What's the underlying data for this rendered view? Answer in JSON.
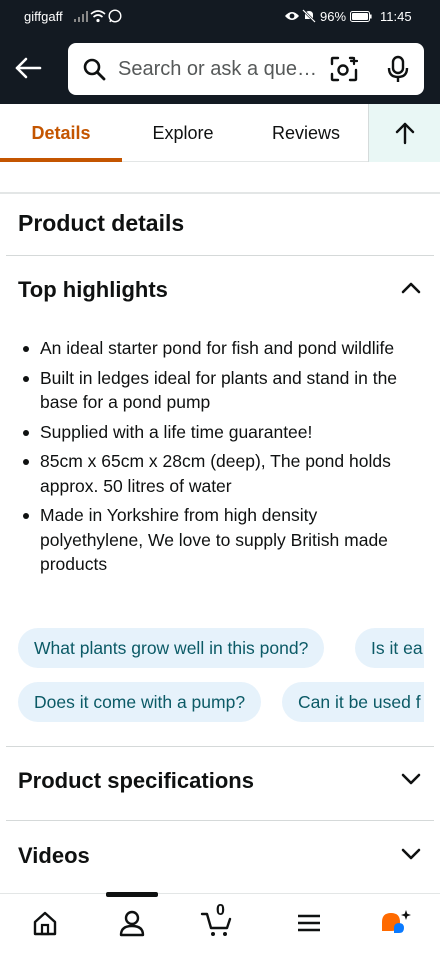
{
  "status_bar": {
    "carrier": "giffgaff",
    "battery": "96%",
    "time": "11:45"
  },
  "header": {
    "search_placeholder": "Search or ask a que…"
  },
  "tabs": [
    {
      "label": "Details",
      "active": true
    },
    {
      "label": "Explore",
      "active": false
    },
    {
      "label": "Reviews",
      "active": false
    }
  ],
  "product_details": {
    "title": "Product details"
  },
  "top_highlights": {
    "title": "Top highlights",
    "expanded": true,
    "items": [
      "An ideal starter pond for fish and pond wildlife",
      "Built in ledges ideal for plants and stand in the base for a pond pump",
      "Supplied with a life time guarantee!",
      "85cm x 65cm x 28cm (deep), The pond holds approx. 50 litres of water",
      "Made in Yorkshire from high density polyethylene, We love to supply British made products"
    ]
  },
  "questions": {
    "row1": [
      "What plants grow well in this pond?",
      "Is it ea"
    ],
    "row2": [
      "Does it come with a pump?",
      "Can it be used f"
    ]
  },
  "sections": {
    "specifications": "Product specifications",
    "videos": "Videos"
  },
  "colors": {
    "header_bg": "#131a22",
    "tab_active": "#c45500",
    "chip_bg": "#e6f2fb",
    "chip_text": "#0b5a66",
    "assistant_orange": "#ff6a00",
    "assistant_blue": "#0a7aff"
  },
  "icons": {
    "back": "arrow-left-icon",
    "search": "search-icon",
    "camera": "camera-lens-icon",
    "mic": "microphone-icon",
    "top": "arrow-up-icon",
    "home": "home-icon",
    "account": "person-icon",
    "cart": "cart-icon",
    "menu": "menu-icon",
    "assistant": "rufus-assistant-icon"
  },
  "cart_count": "0"
}
